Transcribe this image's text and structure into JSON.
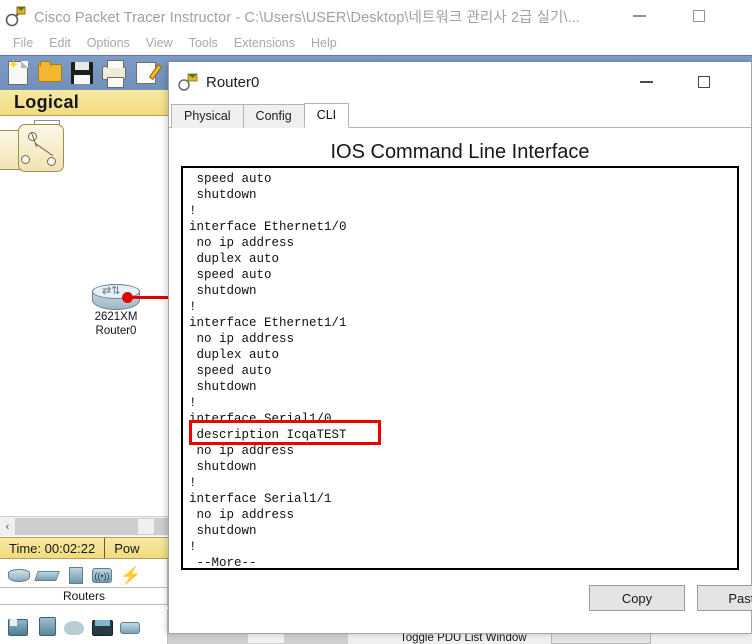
{
  "app": {
    "title": "Cisco Packet Tracer Instructor - C:\\Users\\USER\\Desktop\\네트워크 관리사 2급 실기\\...",
    "title_icon": "packet-tracer-icon",
    "minimize_label": "Minimize",
    "maximize_label": "Maximize"
  },
  "menubar": {
    "items": [
      {
        "label": "File"
      },
      {
        "label": "Edit"
      },
      {
        "label": "Options"
      },
      {
        "label": "View"
      },
      {
        "label": "Tools"
      },
      {
        "label": "Extensions"
      },
      {
        "label": "Help"
      }
    ]
  },
  "toolbar": {
    "icons": [
      {
        "name": "new-file-icon"
      },
      {
        "name": "open-file-icon"
      },
      {
        "name": "save-file-icon"
      },
      {
        "name": "print-icon"
      },
      {
        "name": "activity-wizard-icon"
      },
      {
        "name": "undo-icon"
      },
      {
        "name": "redo-icon"
      },
      {
        "name": "zoom-in-icon"
      },
      {
        "name": "zoom-reset-icon"
      },
      {
        "name": "zoom-out-icon"
      },
      {
        "name": "network-info-icon"
      }
    ]
  },
  "workspace": {
    "mode_label": "Logical",
    "brackets": "[",
    "navigation_icon": "logical-view-icon",
    "devices": [
      {
        "name": "router0",
        "model": "2621XM",
        "label": "Router0",
        "icon": "router-icon"
      }
    ],
    "link_color": "#e00000"
  },
  "statusbar": {
    "time_label": "Time: 00:02:22",
    "power_label": "Pow"
  },
  "device_panel": {
    "category_label": "Routers",
    "type_icons": [
      {
        "name": "routers-category-icon"
      },
      {
        "name": "switches-category-icon"
      },
      {
        "name": "hubs-category-icon"
      },
      {
        "name": "wireless-devices-category-icon"
      },
      {
        "name": "connections-category-icon"
      }
    ],
    "palette_icons": [
      {
        "name": "device-generic-router-icon"
      },
      {
        "name": "device-router-1841-icon"
      },
      {
        "name": "device-cloud-icon"
      },
      {
        "name": "device-pc-icon"
      },
      {
        "name": "device-switch-icon"
      }
    ]
  },
  "bottom_bar": {
    "pdu_list_label": "Toggle PDU List Window"
  },
  "dialog": {
    "title": "Router0",
    "title_icon": "router-device-icon",
    "minimize_label": "Minimize",
    "maximize_label": "Maximize",
    "tabs": [
      {
        "label": "Physical",
        "active": false
      },
      {
        "label": "Config",
        "active": false
      },
      {
        "label": "CLI",
        "active": true
      }
    ],
    "heading": "IOS Command Line Interface",
    "cli_text": " speed auto\n shutdown\n!\ninterface Ethernet1/0\n no ip address\n duplex auto\n speed auto\n shutdown\n!\ninterface Ethernet1/1\n no ip address\n duplex auto\n speed auto\n shutdown\n!\ninterface Serial1/0\n description IcqaTEST\n no ip address\n shutdown\n!\ninterface Serial1/1\n no ip address\n shutdown\n!\n --More--",
    "highlight": {
      "text": "description IcqaTEST",
      "color": "#ee0000"
    },
    "buttons": [
      {
        "name": "copy",
        "label": "Copy"
      },
      {
        "name": "paste",
        "label": "Paste"
      }
    ]
  }
}
